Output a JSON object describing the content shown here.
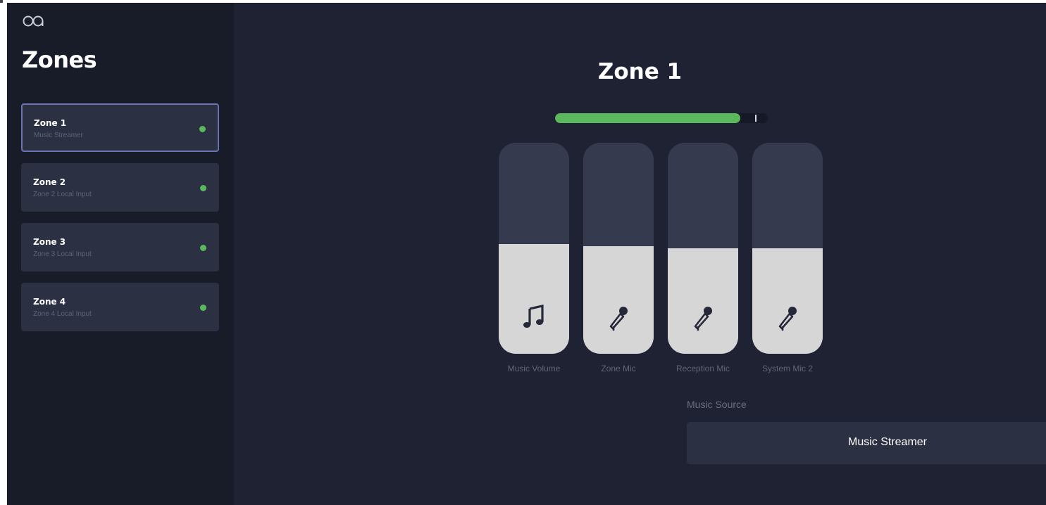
{
  "sidebar": {
    "logo_icon": "infinity-logo-icon",
    "title": "Zones",
    "items": [
      {
        "name": "Zone 1",
        "subtitle": "Music Streamer",
        "selected": true,
        "status_color": "#5cb85c"
      },
      {
        "name": "Zone 2",
        "subtitle": "Zone 2 Local Input",
        "selected": false,
        "status_color": "#5cb85c"
      },
      {
        "name": "Zone 3",
        "subtitle": "Zone 3 Local Input",
        "selected": false,
        "status_color": "#5cb85c"
      },
      {
        "name": "Zone 4",
        "subtitle": "Zone 4 Local Input",
        "selected": false,
        "status_color": "#5cb85c"
      }
    ]
  },
  "main": {
    "title": "Zone 1",
    "level_meter": {
      "level": 0.87,
      "peak": 0.94,
      "color": "#5cb85c"
    },
    "faders": [
      {
        "label": "Music Volume",
        "icon": "music-note-icon",
        "level": 0.52
      },
      {
        "label": "Zone Mic",
        "icon": "microphone-icon",
        "level": 0.51
      },
      {
        "label": "Reception Mic",
        "icon": "microphone-icon",
        "level": 0.5
      },
      {
        "label": "System Mic 2",
        "icon": "microphone-icon",
        "level": 0.5
      }
    ],
    "music_source": {
      "label": "Music Source",
      "value": "Music Streamer",
      "chevron_icon": "chevron-right-icon"
    }
  },
  "colors": {
    "background": "#1e2232",
    "sidebar": "#181b28",
    "card": "#2c3043",
    "accent_green": "#5cb85c",
    "selected_border": "#6b73b0"
  }
}
